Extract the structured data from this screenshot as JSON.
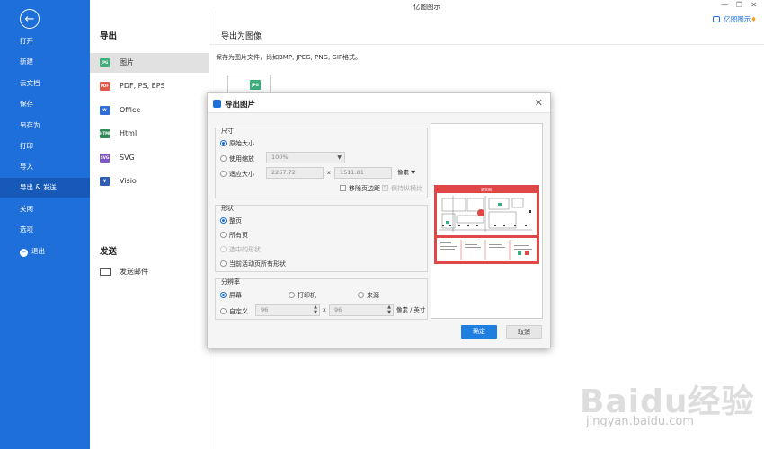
{
  "app": {
    "title": "亿图图示",
    "brand": "亿图图示"
  },
  "sidebar": {
    "items": [
      {
        "label": "打开"
      },
      {
        "label": "新建"
      },
      {
        "label": "云文档"
      },
      {
        "label": "保存"
      },
      {
        "label": "另存为"
      },
      {
        "label": "打印"
      },
      {
        "label": "导入"
      },
      {
        "label": "导出 & 发送"
      },
      {
        "label": "关闭"
      },
      {
        "label": "选项"
      },
      {
        "label": "退出"
      }
    ]
  },
  "export": {
    "heading": "导出",
    "formats": [
      {
        "label": "图片",
        "badge": "JPG",
        "color": "#3cae7c"
      },
      {
        "label": "PDF, PS, EPS",
        "badge": "PDF",
        "color": "#e05a4a"
      },
      {
        "label": "Office",
        "badge": "W",
        "color": "#2f6ed6"
      },
      {
        "label": "Html",
        "badge": "HTML",
        "color": "#2e8b57"
      },
      {
        "label": "SVG",
        "badge": "SVG",
        "color": "#7e57c2"
      },
      {
        "label": "Visio",
        "badge": "V",
        "color": "#2f5fb6"
      }
    ],
    "send_heading": "发送",
    "send_mail": "发送邮件"
  },
  "content": {
    "heading": "导出为图像",
    "description": "保存为图片文件，比如BMP, JPEG, PNG, GIF格式。",
    "thumb_badge": "JPG"
  },
  "dialog": {
    "title": "导出图片",
    "size": {
      "label": "尺寸",
      "original": "原始大小",
      "use_zoom": "使用缩放",
      "zoom_value": "100%",
      "fit_size": "适应大小",
      "width": "2267.72",
      "x": "x",
      "height": "1511.81",
      "unit": "像素",
      "remove_margin": "移除页边距",
      "keep_ratio": "保持纵横比"
    },
    "shape": {
      "label": "形状",
      "whole_page": "整页",
      "all_pages": "所有页",
      "selected": "选中的形状",
      "current_layer": "当前活动页所有形状"
    },
    "resolution": {
      "label": "分辨率",
      "screen": "屏幕",
      "printer": "打印机",
      "source": "来源",
      "custom": "自定义",
      "dpi_x": "96",
      "x": "x",
      "dpi_y": "96",
      "unit": "像素 / 英寸"
    },
    "preview": {
      "banner": "逃生图"
    },
    "ok": "确定",
    "cancel": "取消"
  },
  "watermark": {
    "text": "Baidu经验",
    "url": "jingyan.baidu.com"
  }
}
